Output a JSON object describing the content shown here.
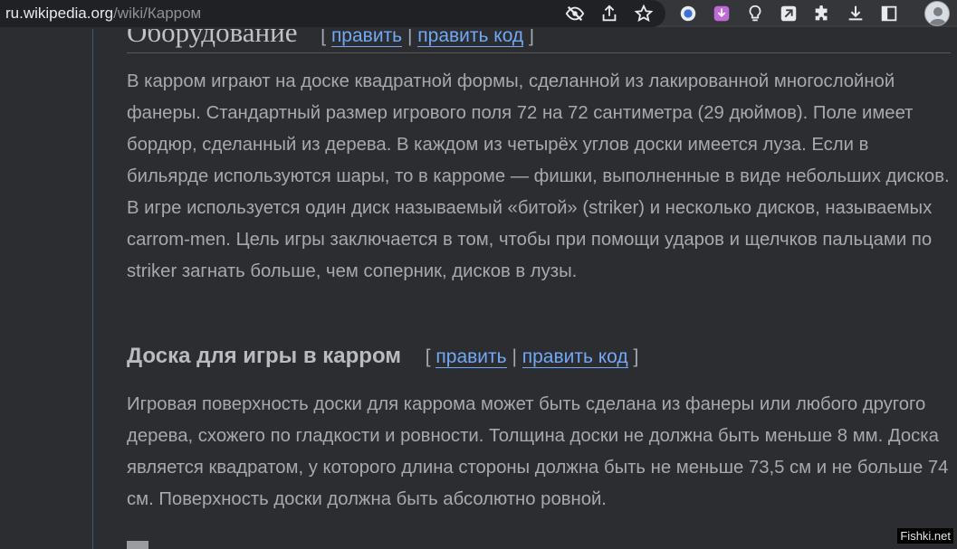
{
  "browser": {
    "url_host": "ru.wikipedia.org",
    "url_path": "/wiki/Карром",
    "icons": [
      "eye-off-icon",
      "share-icon",
      "star-icon",
      "extension-icons",
      "puzzle-icon",
      "download-icon",
      "sidepanel-icon",
      "profile-avatar"
    ]
  },
  "article": {
    "section_title": "Оборудование",
    "edit_open": "[",
    "edit_label": "править",
    "edit_sep": "|",
    "edit_code_label": "править код",
    "edit_close": "]",
    "paragraph_1": "В карром играют на доске квадратной формы, сделанной из лакированной многослойной фанеры. Стандартный размер игрового поля 72 на 72 сантиметра (29 дюймов). Поле имеет бордюр, сделанный из дерева. В каждом из четырёх углов доски имеется луза. Если в бильярде используются шары, то в карроме — фишки, выполненные в виде небольших дисков. В игре используется один диск называемый «битой» (striker) и несколько дисков, называемых carrom-men. Цель игры заключается в том, чтобы при помощи ударов и щелчков пальцами по striker загнать больше, чем соперник, дисков в лузы.",
    "subsection_title": "Доска для игры в карром",
    "paragraph_2": "Игровая поверхность доски для каррома может быть сделана из фанеры или любого другого дерева, схожего по гладкости и ровности. Толщина доски не должна быть меньше 8 мм. Доска является квадратом, у которого длина стороны должна быть не меньше 73,5 см и не больше 74 см. Поверхность доски должна быть абсолютно ровной."
  },
  "watermark": "Fishki.net",
  "colors": {
    "background": "#2b2d30",
    "text": "#a6a9ad",
    "link": "#72a8f5"
  }
}
